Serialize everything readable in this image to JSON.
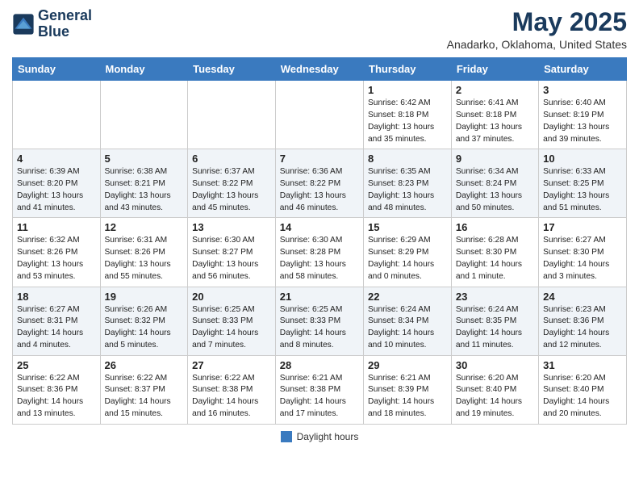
{
  "header": {
    "logo_line1": "General",
    "logo_line2": "Blue",
    "month_year": "May 2025",
    "location": "Anadarko, Oklahoma, United States"
  },
  "weekdays": [
    "Sunday",
    "Monday",
    "Tuesday",
    "Wednesday",
    "Thursday",
    "Friday",
    "Saturday"
  ],
  "weeks": [
    [
      {
        "day": "",
        "info": ""
      },
      {
        "day": "",
        "info": ""
      },
      {
        "day": "",
        "info": ""
      },
      {
        "day": "",
        "info": ""
      },
      {
        "day": "1",
        "info": "Sunrise: 6:42 AM\nSunset: 8:18 PM\nDaylight: 13 hours\nand 35 minutes."
      },
      {
        "day": "2",
        "info": "Sunrise: 6:41 AM\nSunset: 8:18 PM\nDaylight: 13 hours\nand 37 minutes."
      },
      {
        "day": "3",
        "info": "Sunrise: 6:40 AM\nSunset: 8:19 PM\nDaylight: 13 hours\nand 39 minutes."
      }
    ],
    [
      {
        "day": "4",
        "info": "Sunrise: 6:39 AM\nSunset: 8:20 PM\nDaylight: 13 hours\nand 41 minutes."
      },
      {
        "day": "5",
        "info": "Sunrise: 6:38 AM\nSunset: 8:21 PM\nDaylight: 13 hours\nand 43 minutes."
      },
      {
        "day": "6",
        "info": "Sunrise: 6:37 AM\nSunset: 8:22 PM\nDaylight: 13 hours\nand 45 minutes."
      },
      {
        "day": "7",
        "info": "Sunrise: 6:36 AM\nSunset: 8:22 PM\nDaylight: 13 hours\nand 46 minutes."
      },
      {
        "day": "8",
        "info": "Sunrise: 6:35 AM\nSunset: 8:23 PM\nDaylight: 13 hours\nand 48 minutes."
      },
      {
        "day": "9",
        "info": "Sunrise: 6:34 AM\nSunset: 8:24 PM\nDaylight: 13 hours\nand 50 minutes."
      },
      {
        "day": "10",
        "info": "Sunrise: 6:33 AM\nSunset: 8:25 PM\nDaylight: 13 hours\nand 51 minutes."
      }
    ],
    [
      {
        "day": "11",
        "info": "Sunrise: 6:32 AM\nSunset: 8:26 PM\nDaylight: 13 hours\nand 53 minutes."
      },
      {
        "day": "12",
        "info": "Sunrise: 6:31 AM\nSunset: 8:26 PM\nDaylight: 13 hours\nand 55 minutes."
      },
      {
        "day": "13",
        "info": "Sunrise: 6:30 AM\nSunset: 8:27 PM\nDaylight: 13 hours\nand 56 minutes."
      },
      {
        "day": "14",
        "info": "Sunrise: 6:30 AM\nSunset: 8:28 PM\nDaylight: 13 hours\nand 58 minutes."
      },
      {
        "day": "15",
        "info": "Sunrise: 6:29 AM\nSunset: 8:29 PM\nDaylight: 14 hours\nand 0 minutes."
      },
      {
        "day": "16",
        "info": "Sunrise: 6:28 AM\nSunset: 8:30 PM\nDaylight: 14 hours\nand 1 minute."
      },
      {
        "day": "17",
        "info": "Sunrise: 6:27 AM\nSunset: 8:30 PM\nDaylight: 14 hours\nand 3 minutes."
      }
    ],
    [
      {
        "day": "18",
        "info": "Sunrise: 6:27 AM\nSunset: 8:31 PM\nDaylight: 14 hours\nand 4 minutes."
      },
      {
        "day": "19",
        "info": "Sunrise: 6:26 AM\nSunset: 8:32 PM\nDaylight: 14 hours\nand 5 minutes."
      },
      {
        "day": "20",
        "info": "Sunrise: 6:25 AM\nSunset: 8:33 PM\nDaylight: 14 hours\nand 7 minutes."
      },
      {
        "day": "21",
        "info": "Sunrise: 6:25 AM\nSunset: 8:33 PM\nDaylight: 14 hours\nand 8 minutes."
      },
      {
        "day": "22",
        "info": "Sunrise: 6:24 AM\nSunset: 8:34 PM\nDaylight: 14 hours\nand 10 minutes."
      },
      {
        "day": "23",
        "info": "Sunrise: 6:24 AM\nSunset: 8:35 PM\nDaylight: 14 hours\nand 11 minutes."
      },
      {
        "day": "24",
        "info": "Sunrise: 6:23 AM\nSunset: 8:36 PM\nDaylight: 14 hours\nand 12 minutes."
      }
    ],
    [
      {
        "day": "25",
        "info": "Sunrise: 6:22 AM\nSunset: 8:36 PM\nDaylight: 14 hours\nand 13 minutes."
      },
      {
        "day": "26",
        "info": "Sunrise: 6:22 AM\nSunset: 8:37 PM\nDaylight: 14 hours\nand 15 minutes."
      },
      {
        "day": "27",
        "info": "Sunrise: 6:22 AM\nSunset: 8:38 PM\nDaylight: 14 hours\nand 16 minutes."
      },
      {
        "day": "28",
        "info": "Sunrise: 6:21 AM\nSunset: 8:38 PM\nDaylight: 14 hours\nand 17 minutes."
      },
      {
        "day": "29",
        "info": "Sunrise: 6:21 AM\nSunset: 8:39 PM\nDaylight: 14 hours\nand 18 minutes."
      },
      {
        "day": "30",
        "info": "Sunrise: 6:20 AM\nSunset: 8:40 PM\nDaylight: 14 hours\nand 19 minutes."
      },
      {
        "day": "31",
        "info": "Sunrise: 6:20 AM\nSunset: 8:40 PM\nDaylight: 14 hours\nand 20 minutes."
      }
    ]
  ],
  "footer": {
    "label": "Daylight hours"
  }
}
